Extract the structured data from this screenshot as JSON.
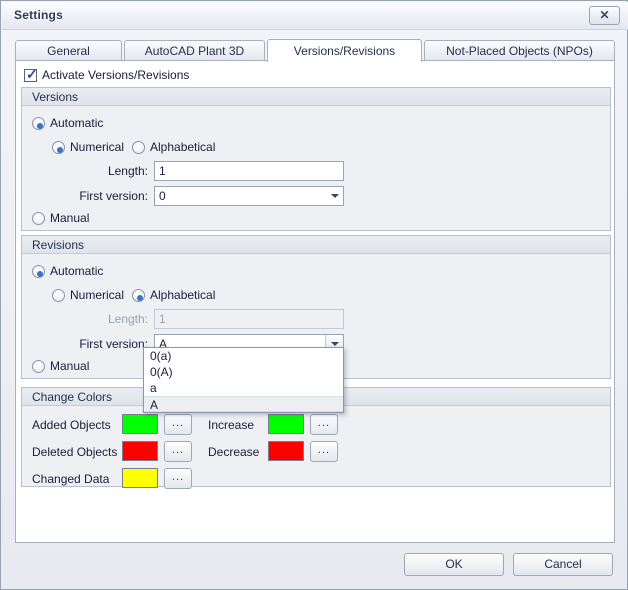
{
  "window": {
    "title": "Settings",
    "close_label": "✕"
  },
  "tabs": [
    {
      "label": "General",
      "active": false
    },
    {
      "label": "AutoCAD Plant 3D",
      "active": false
    },
    {
      "label": "Versions/Revisions",
      "active": true
    },
    {
      "label": "Not-Placed Objects (NPOs)",
      "active": false
    }
  ],
  "activate": {
    "label": "Activate Versions/Revisions",
    "checked": true,
    "check_glyph": "✓"
  },
  "versions": {
    "title": "Versions",
    "automatic_label": "Automatic",
    "automatic_selected": true,
    "numerical_label": "Numerical",
    "numerical_selected": true,
    "alphabetical_label": "Alphabetical",
    "alphabetical_selected": false,
    "length_label": "Length:",
    "length_value": "1",
    "first_version_label": "First version:",
    "first_version_value": "0",
    "manual_label": "Manual",
    "manual_selected": false
  },
  "revisions": {
    "title": "Revisions",
    "automatic_label": "Automatic",
    "automatic_selected": true,
    "numerical_label": "Numerical",
    "numerical_selected": false,
    "alphabetical_label": "Alphabetical",
    "alphabetical_selected": true,
    "length_label": "Length:",
    "length_value": "1",
    "length_disabled": true,
    "first_version_label": "First version:",
    "first_version_value": "A",
    "manual_label": "Manual",
    "manual_selected": false,
    "dropdown_open": true,
    "dropdown_options": [
      {
        "label": "0(a)",
        "highlighted": false
      },
      {
        "label": "0(A)",
        "highlighted": false
      },
      {
        "label": "a",
        "highlighted": false
      },
      {
        "label": "A",
        "highlighted": true
      }
    ]
  },
  "change_colors": {
    "title": "Change Colors",
    "browse_label": "...",
    "rows_left": [
      {
        "label": "Added Objects",
        "color": "#00FF00"
      },
      {
        "label": "Deleted Objects",
        "color": "#FF0000"
      },
      {
        "label": "Changed Data",
        "color": "#FFFF00"
      }
    ],
    "rows_right": [
      {
        "label": "Increase",
        "color": "#00FF00"
      },
      {
        "label": "Decrease",
        "color": "#FF0000"
      }
    ]
  },
  "footer": {
    "ok_label": "OK",
    "cancel_label": "Cancel"
  }
}
